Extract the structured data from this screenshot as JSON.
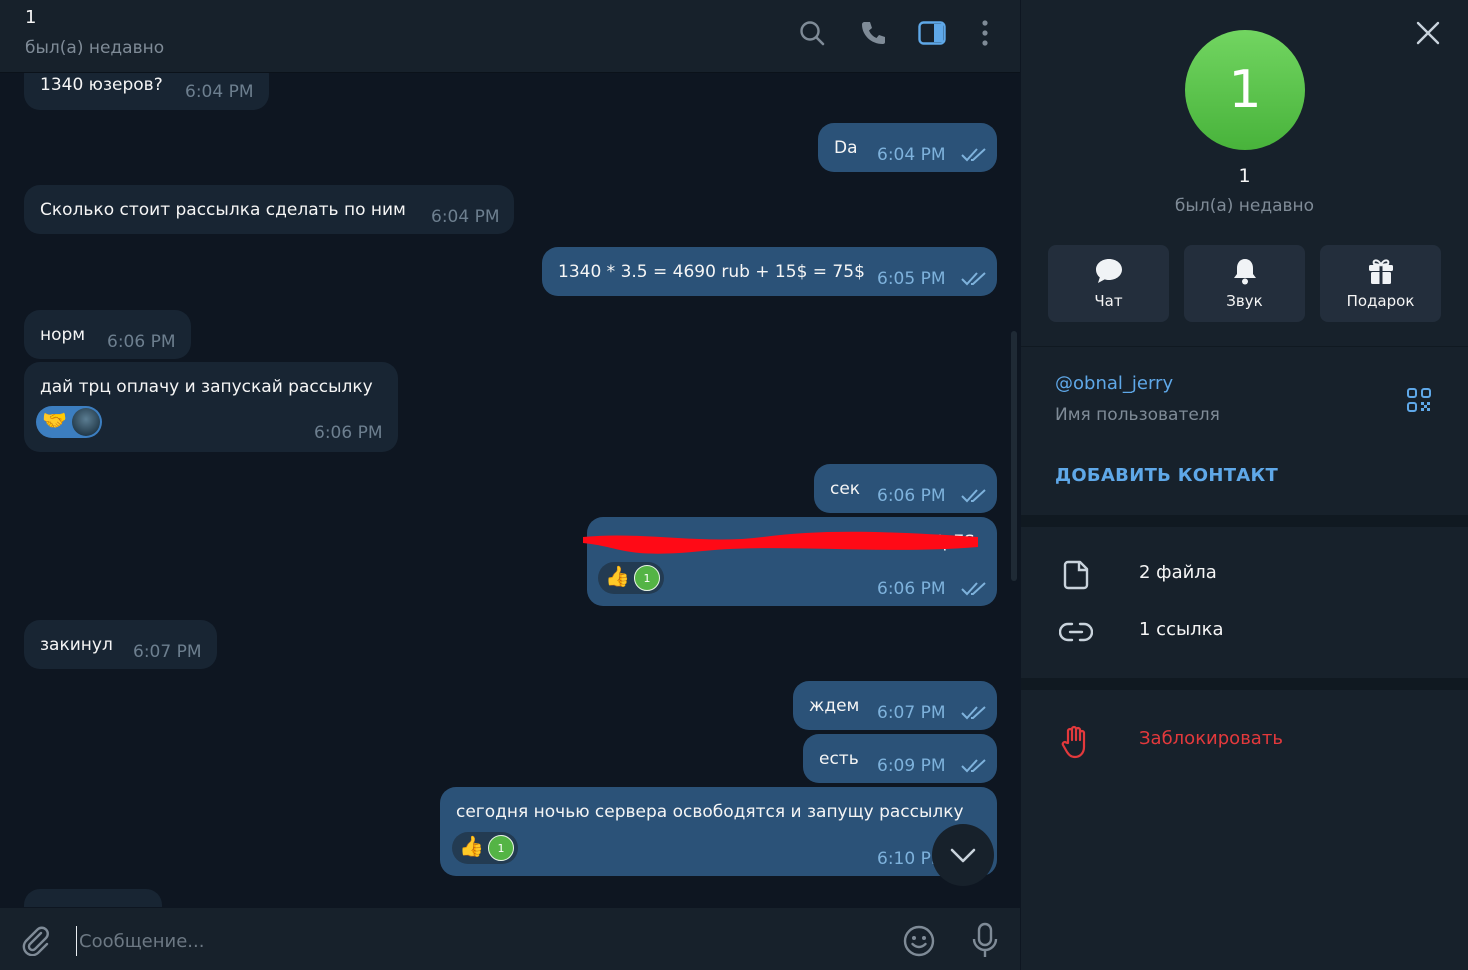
{
  "header": {
    "title": "1",
    "status": "был(а) недавно"
  },
  "messages": [
    {
      "dir": "in",
      "text": "1340 юзеров?",
      "time": "6:04 PM"
    },
    {
      "dir": "out",
      "text": "Da",
      "time": "6:04 PM"
    },
    {
      "dir": "in",
      "text": "Сколько стоит рассылка сделать по ним",
      "time": "6:04 PM"
    },
    {
      "dir": "out",
      "text": "1340 * 3.5 = 4690 rub + 15$ = 75$",
      "time": "6:05 PM"
    },
    {
      "dir": "in",
      "text": "норм",
      "time": "6:06 PM"
    },
    {
      "dir": "in",
      "text": "дай трц оплачу и запускай рассылку",
      "time": "6:06 PM",
      "reaction": "🤝"
    },
    {
      "dir": "out",
      "text": "сек",
      "time": "6:06 PM"
    },
    {
      "dir": "out",
      "text": "CFTNpES",
      "time": "6:06 PM",
      "reaction": "👍",
      "reaction_count": "1",
      "redacted": true
    },
    {
      "dir": "in",
      "text": "закинул",
      "time": "6:07 PM"
    },
    {
      "dir": "out",
      "text": "ждем",
      "time": "6:07 PM"
    },
    {
      "dir": "out",
      "text": "есть",
      "time": "6:09 PM"
    },
    {
      "dir": "out",
      "text": "сегодня ночью сервера освободятся и запущу рассылку",
      "time": "6:10 PM",
      "reaction": "👍",
      "reaction_count": "1"
    }
  ],
  "composer": {
    "placeholder": "Сообщение..."
  },
  "profile": {
    "avatar_letter": "1",
    "name": "1",
    "status": "был(а) недавно",
    "actions": {
      "chat": "Чат",
      "sound": "Звук",
      "gift": "Подарок"
    },
    "username": "@obnal_jerry",
    "username_label": "Имя пользователя",
    "add_contact": "ДОБАВИТЬ КОНТАКТ",
    "files": "2 файла",
    "links": "1 ссылка",
    "block": "Заблокировать"
  },
  "colors": {
    "chat_bg": "#0e1621",
    "panel_bg": "#17212b",
    "incoming_bubble": "#182533",
    "outgoing_bubble": "#2b5278",
    "accent": "#5fa8e8",
    "danger": "#e3393c",
    "avatar_green": "#54b445"
  }
}
